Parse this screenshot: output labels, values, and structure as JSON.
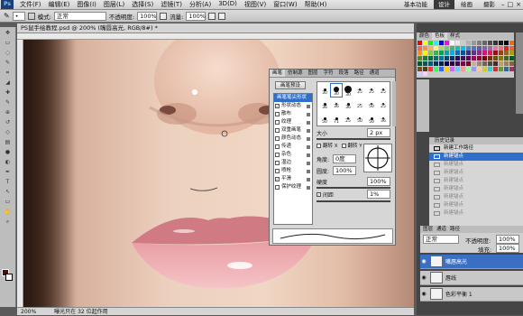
{
  "menubar": {
    "logo": "Ps",
    "items": [
      "文件(F)",
      "编辑(E)",
      "图像(I)",
      "图层(L)",
      "选择(S)",
      "滤镜(T)",
      "分析(A)",
      "3D(D)",
      "视图(V)",
      "窗口(W)",
      "帮助(H)"
    ],
    "workspaces": [
      "基本功能",
      "设计",
      "绘画",
      "摄影"
    ],
    "active_workspace": "设计"
  },
  "options": {
    "mode_label": "模式:",
    "mode_value": "正常",
    "opacity_label": "不透明度:",
    "opacity_value": "100%",
    "flow_label": "流量:",
    "flow_value": "100%"
  },
  "document": {
    "tab_title": "PS鼠手绘教程.psd @ 200% (嘴唇高光, RGB/8#) *",
    "zoom": "200%",
    "status": "曝光只在 32 位起作用"
  },
  "brush_panel": {
    "tabs": [
      "画笔",
      "仿制源",
      "图层",
      "字符",
      "段落",
      "路径",
      "通道"
    ],
    "active_tab": "画笔",
    "preset_button": "画笔预设",
    "options": [
      {
        "label": "画笔笔尖形状",
        "checked": null,
        "selected": true
      },
      {
        "label": "形状动态",
        "checked": true,
        "selected": false
      },
      {
        "label": "散布",
        "checked": false,
        "selected": false
      },
      {
        "label": "纹理",
        "checked": false,
        "selected": false
      },
      {
        "label": "双重画笔",
        "checked": false,
        "selected": false
      },
      {
        "label": "颜色动态",
        "checked": false,
        "selected": false
      },
      {
        "label": "传递",
        "checked": false,
        "selected": false
      },
      {
        "label": "杂色",
        "checked": false,
        "selected": false
      },
      {
        "label": "湿边",
        "checked": false,
        "selected": false
      },
      {
        "label": "喷枪",
        "checked": false,
        "selected": false
      },
      {
        "label": "平滑",
        "checked": true,
        "selected": false
      },
      {
        "label": "保护纹理",
        "checked": false,
        "selected": false
      }
    ],
    "tips": [
      {
        "size": "30",
        "dot": 3
      },
      {
        "size": "30",
        "dot": 6
      },
      {
        "size": "30",
        "dot": 8
      },
      {
        "size": "25",
        "dot": 2
      },
      {
        "size": "25",
        "dot": 2
      },
      {
        "size": "25",
        "dot": 2
      },
      {
        "size": "36",
        "dot": 3
      },
      {
        "size": "36",
        "dot": 2
      },
      {
        "size": "36",
        "dot": 3
      },
      {
        "size": "25",
        "dot": 1
      },
      {
        "size": "50",
        "dot": 2
      },
      {
        "size": "25",
        "dot": 2
      },
      {
        "size": "50",
        "dot": 3
      },
      {
        "size": "71",
        "dot": 3
      },
      {
        "size": "25",
        "dot": 2
      },
      {
        "size": "50",
        "dot": 2
      },
      {
        "size": "50",
        "dot": 3
      },
      {
        "size": "36",
        "dot": 2
      }
    ],
    "size_label": "大小",
    "size_value": "2 px",
    "flip_x": "翻转 X",
    "flip_y": "翻转 Y",
    "angle_label": "角度:",
    "angle_value": "0度",
    "roundness_label": "圆度:",
    "roundness_value": "100%",
    "hardness_label": "硬度",
    "hardness_value": "100%",
    "spacing_label": "间距",
    "spacing_value": "1%"
  },
  "history": {
    "title": "历史记录",
    "items": [
      {
        "label": "新建工作路径",
        "state": "normal"
      },
      {
        "label": "新建锚点",
        "state": "active"
      },
      {
        "label": "新建锚点",
        "state": "dim"
      },
      {
        "label": "新建锚点",
        "state": "dim"
      },
      {
        "label": "新建锚点",
        "state": "dim"
      },
      {
        "label": "新建锚点",
        "state": "dim"
      },
      {
        "label": "新建锚点",
        "state": "dim"
      },
      {
        "label": "新建锚点",
        "state": "dim"
      },
      {
        "label": "新建锚点",
        "state": "dim"
      }
    ]
  },
  "layers": {
    "tabs": [
      "图层",
      "通道",
      "路径"
    ],
    "blend_mode": "正常",
    "opacity_label": "不透明度:",
    "opacity_value": "100%",
    "fill_label": "填充:",
    "fill_value": "100%",
    "rows": [
      {
        "name": "嘴唇高光",
        "active": true
      },
      {
        "name": "唇线",
        "active": false
      },
      {
        "name": "色彩平衡 1",
        "active": false
      }
    ]
  },
  "colors": {
    "accent": "#2f6fc9",
    "swatches": [
      "#ff0000",
      "#ffff00",
      "#00ff00",
      "#00ffff",
      "#0000ff",
      "#ff00ff",
      "#ffffff",
      "#e6e6e6",
      "#cccccc",
      "#b3b3b3",
      "#999999",
      "#808080",
      "#666666",
      "#4d4d4d",
      "#333333",
      "#1a1a1a",
      "#000000",
      "#ff6600",
      "#f26c4f",
      "#f68e56",
      "#fbaf5d",
      "#fff467",
      "#acd373",
      "#7cc576",
      "#3bb878",
      "#1abbb4",
      "#00bff3",
      "#448ccb",
      "#5674b9",
      "#605ca8",
      "#855fa8",
      "#a763a8",
      "#f06ea9",
      "#f26d7d",
      "#ed1c24",
      "#f26522",
      "#f7941d",
      "#fff200",
      "#8dc63f",
      "#39b54a",
      "#00a651",
      "#00a99d",
      "#00aeef",
      "#0072bc",
      "#0054a6",
      "#2e3192",
      "#662d91",
      "#92278f",
      "#ec008c",
      "#ed145b",
      "#9e0b0f",
      "#a0410d",
      "#a36209",
      "#aba000",
      "#598527",
      "#1a7b30",
      "#007236",
      "#00746b",
      "#0076a3",
      "#004a80",
      "#003471",
      "#1b1464",
      "#440e62",
      "#630460",
      "#9e005d",
      "#9e0039",
      "#790000",
      "#7b2e00",
      "#7d4900",
      "#827b00",
      "#406618",
      "#005e20",
      "#005826",
      "#005952",
      "#005b7f",
      "#003663",
      "#002157",
      "#0d004c",
      "#32004b",
      "#4b0049",
      "#7b0046",
      "#7a0026",
      "#c7b299",
      "#998675",
      "#736357",
      "#534741",
      "#37302d",
      "#c69c6d",
      "#a67c52",
      "#8c6239",
      "#754c24",
      "#603913",
      "#ff3333",
      "#33ff66",
      "#3366ff",
      "#ffcc00",
      "#cc66ff",
      "#66ccff",
      "#ff9999",
      "#99ff99",
      "#9999ff",
      "#ffcc99",
      "#cccc33",
      "#33cccc",
      "#cc3333",
      "#669933",
      "#336699",
      "#993366",
      "#ccccff",
      "#ffccff"
    ]
  }
}
